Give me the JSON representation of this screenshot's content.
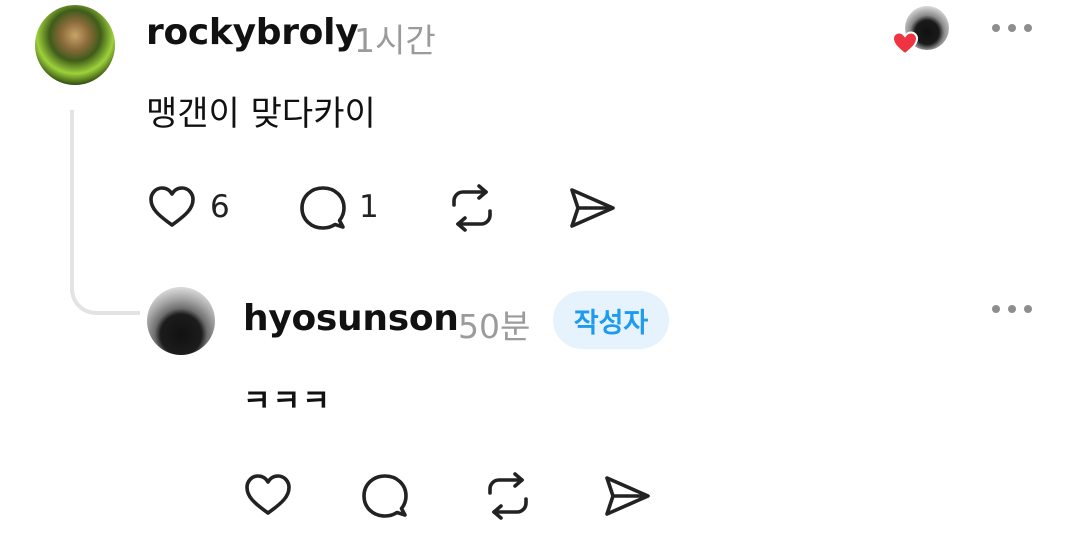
{
  "comments": [
    {
      "username": "rockybroly",
      "time": "1시간",
      "text": "맹갠이 맞다카이",
      "likes": "6",
      "replies": "1",
      "avatar_icon": "user-avatar"
    },
    {
      "username": "hyosunson",
      "time": "50분",
      "badge": "작성자",
      "text": "ㅋㅋㅋ",
      "avatar_icon": "dog-avatar"
    }
  ],
  "icons": {
    "like": "heart-icon",
    "reply": "speech-bubble-icon",
    "repost": "repost-icon",
    "share": "send-icon",
    "more": "more-dots-icon",
    "liked_by": "liked-by-author-icon"
  },
  "colors": {
    "badge_bg": "#e6f3fc",
    "badge_text": "#1d9bf0",
    "heart_red": "#ef3340",
    "muted": "#9b9b9b"
  }
}
